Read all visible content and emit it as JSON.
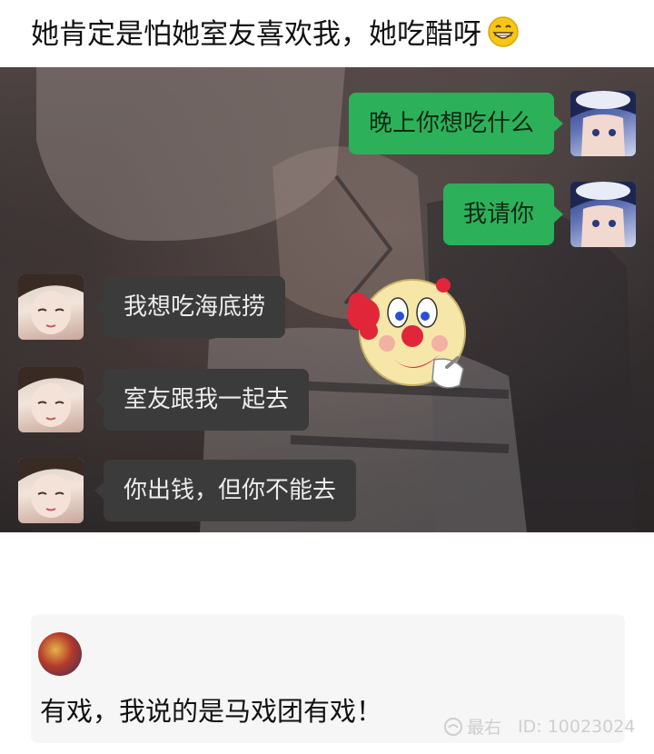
{
  "caption": {
    "text": "她肯定是怕她室友喜欢我，她吃醋呀",
    "emoji_icon": "grinning-face-icon"
  },
  "chat": {
    "messages": [
      {
        "side": "right",
        "text": "晚上你想吃什么"
      },
      {
        "side": "right",
        "text": "我请你"
      },
      {
        "side": "left",
        "text": "我想吃海底捞"
      },
      {
        "side": "left",
        "text": "室友跟我一起去"
      },
      {
        "side": "left",
        "text": "你出钱，但你不能去"
      }
    ],
    "sticker_icon": "clown-face-icon",
    "colors": {
      "sent_bubble": "#2db05a",
      "received_bubble": "#3b3b3b"
    }
  },
  "comment": {
    "text": "有戏，我说的是马戏团有戏！"
  },
  "watermark": {
    "brand": "最右",
    "id_text": "ID: 10023024"
  }
}
